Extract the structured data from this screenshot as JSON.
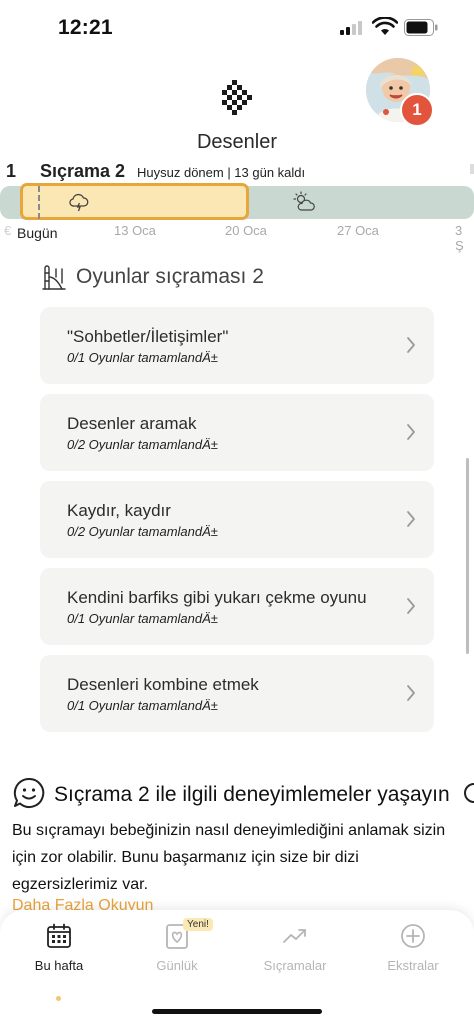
{
  "status_bar": {
    "time": "12:21"
  },
  "header": {
    "title": "Desenler",
    "notification_count": "1"
  },
  "leap": {
    "previous_number": "1",
    "title": "Sıçrama 2",
    "subtitle": "Huysuz dönem | 13 gün kaldı"
  },
  "timeline": {
    "today_label": "Bugün",
    "dates": [
      "13 Oca",
      "20 Oca",
      "27 Oca",
      "3 Ş"
    ],
    "edge_left": "€"
  },
  "games_section": {
    "title": "Oyunlar sıçraması 2",
    "cards": [
      {
        "title": "\"Sohbetler/İletişimler\"",
        "subtitle": "0/1 Oyunlar tamamlandÄ±"
      },
      {
        "title": "Desenler aramak",
        "subtitle": "0/2 Oyunlar tamamlandÄ±"
      },
      {
        "title": "Kaydır, kaydır",
        "subtitle": "0/2 Oyunlar tamamlandÄ±"
      },
      {
        "title": "Kendini barfiks gibi yukarı çekme oyunu",
        "subtitle": "0/1 Oyunlar tamamlandÄ±"
      },
      {
        "title": "Desenleri kombine etmek",
        "subtitle": "0/1 Oyunlar tamamlandÄ±"
      }
    ]
  },
  "experiences": {
    "title": "Sıçrama 2 ile ilgili deneyimlemeler yaşayın",
    "body": "Bu sıçramayı bebeğinizin nasıl deneyimlediğini anlamak sizin için zor olabilir. Bunu başarmanız için size bir dizi egzersizlerimiz var.",
    "read_more": "Daha Fazla Okuyun"
  },
  "tab_bar": {
    "new_badge": "Yeni!",
    "tabs": [
      {
        "label": "Bu hafta",
        "icon": "calendar-icon",
        "active": true
      },
      {
        "label": "Günlük",
        "icon": "journal-heart-icon",
        "active": false
      },
      {
        "label": "Sıçramalar",
        "icon": "trend-up-icon",
        "active": false
      },
      {
        "label": "Ekstralar",
        "icon": "plus-circle-icon",
        "active": false
      }
    ]
  },
  "colors": {
    "accent": "#e7a63b",
    "active_period": "#fbe7b3",
    "timeline_track": "#c9d9d2",
    "badge": "#e2543b",
    "card_bg": "#f4f4f3"
  }
}
